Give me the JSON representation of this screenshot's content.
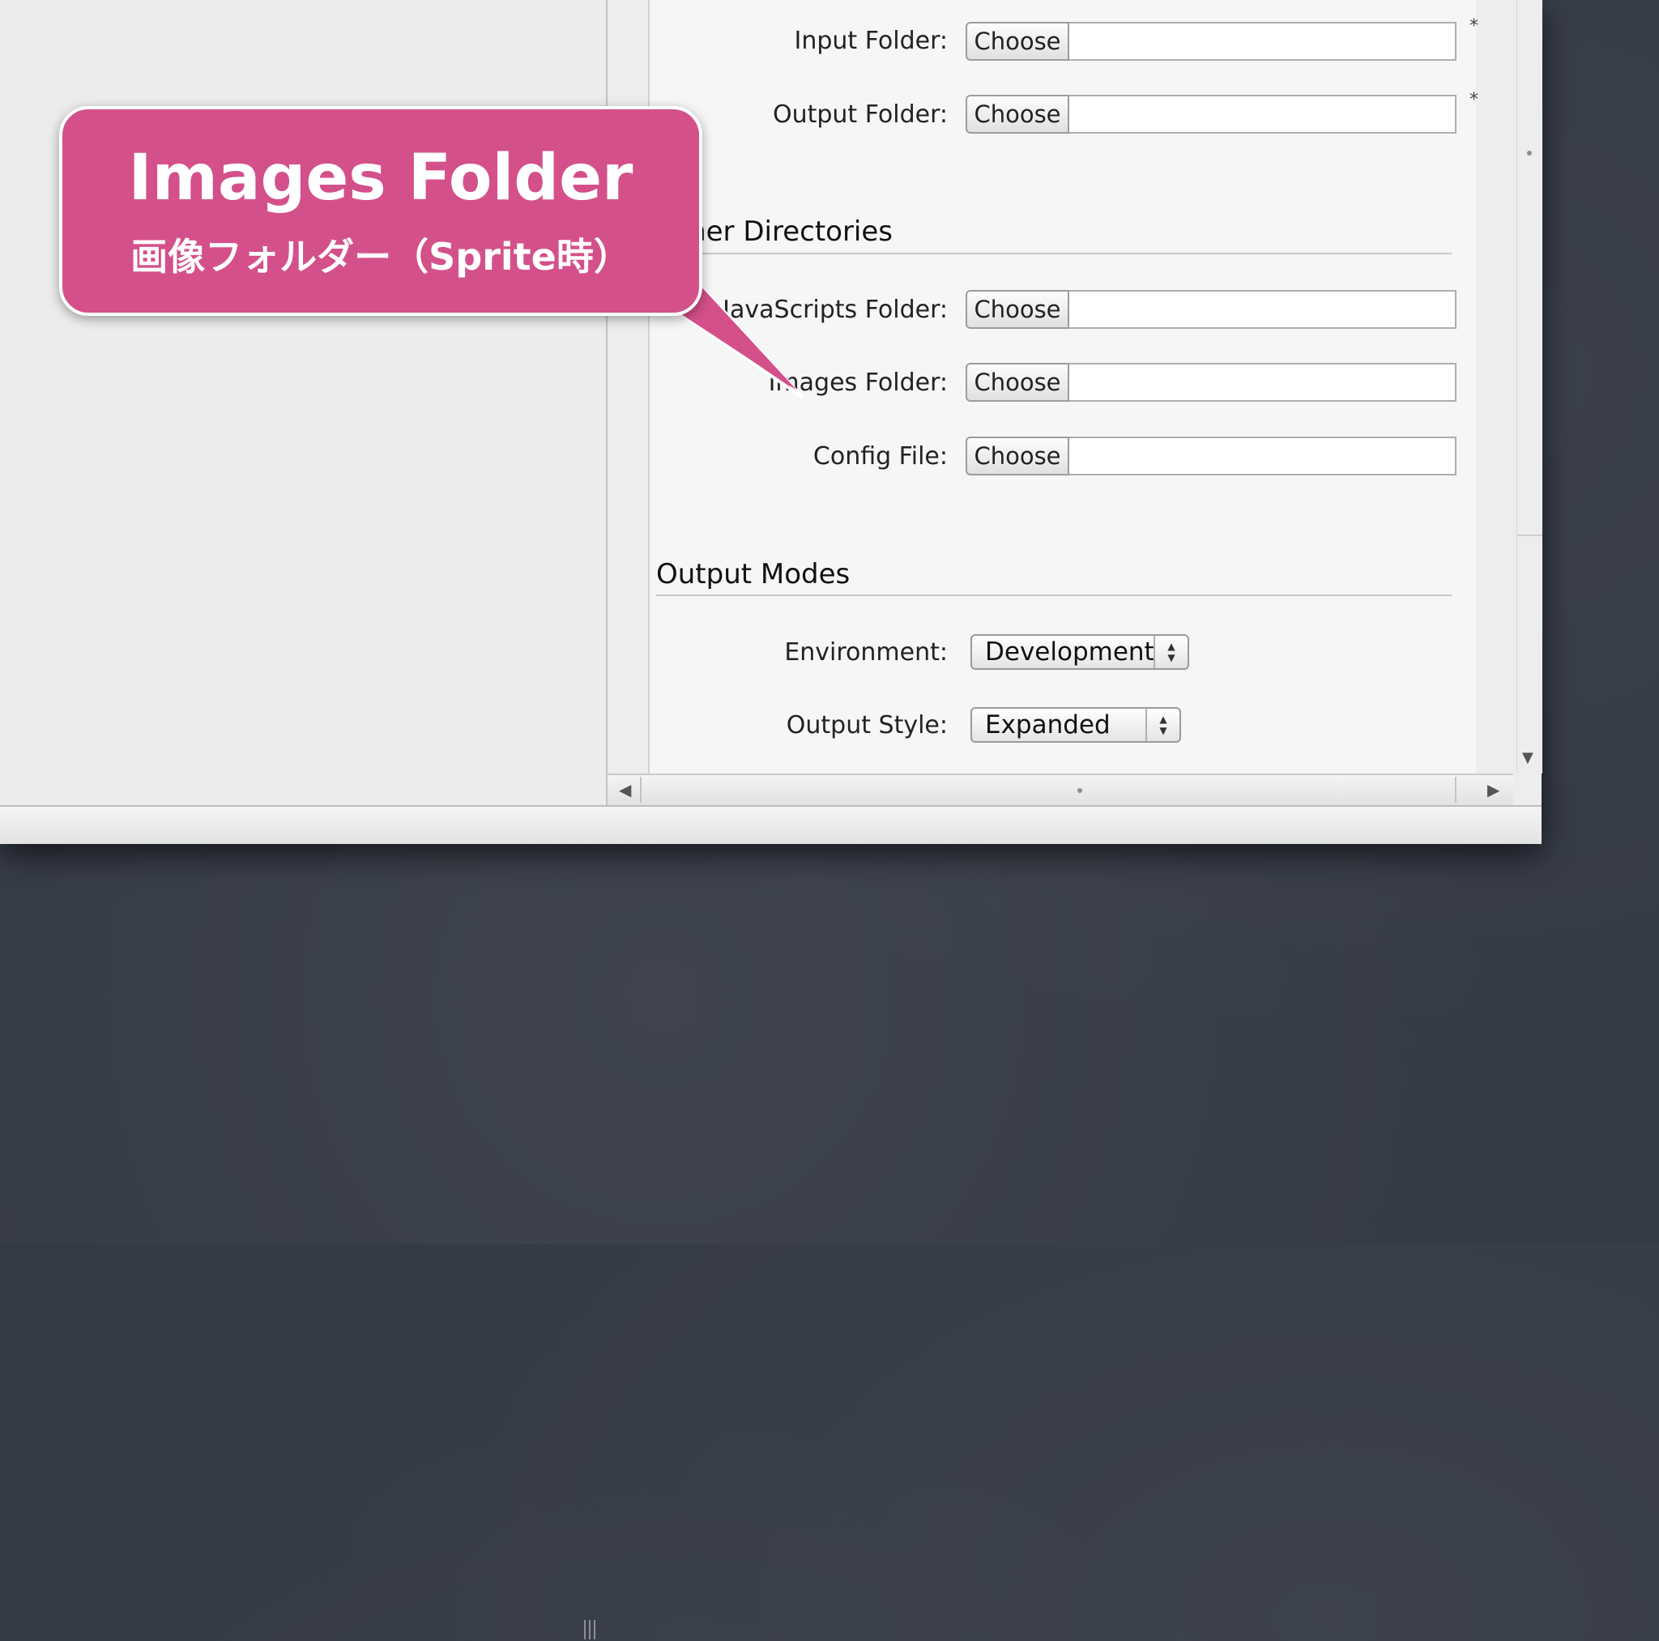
{
  "directories": {
    "rows": [
      {
        "label": "Input Folder:",
        "button": "Choose",
        "required": "*"
      },
      {
        "label": "Output Folder:",
        "button": "Choose",
        "required": "*"
      }
    ]
  },
  "other_directories": {
    "title": "Other Directories",
    "rows": [
      {
        "label": "JavaScripts Folder:",
        "button": "Choose"
      },
      {
        "label": "Images Folder:",
        "button": "Choose"
      },
      {
        "label": "Config File:",
        "button": "Choose"
      }
    ]
  },
  "output_modes": {
    "title": "Output Modes",
    "environment": {
      "label": "Environment:",
      "value": "Development"
    },
    "output_style": {
      "label": "Output Style:",
      "value": "Expanded"
    }
  },
  "callout": {
    "title": "Images Folder",
    "subtitle": "画像フォルダー（Sprite時）",
    "color": "#d4508a"
  },
  "icons": {
    "scroll_left": "triangle-left-icon",
    "scroll_right": "triangle-right-icon",
    "scroll_down": "triangle-down-icon",
    "split_handle": "split-grip-icon"
  }
}
